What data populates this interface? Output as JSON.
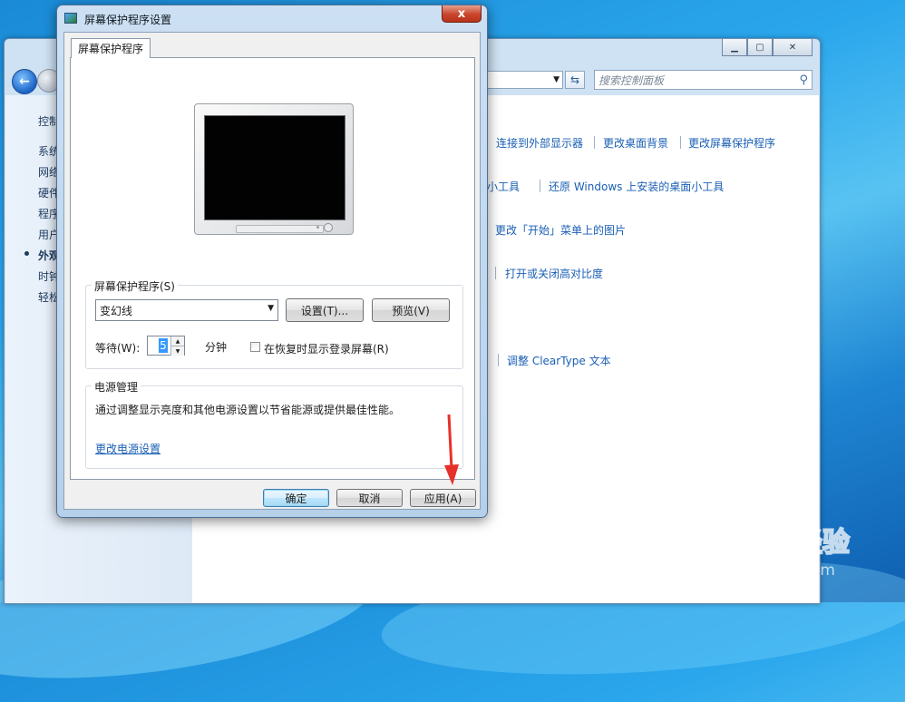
{
  "background_window": {
    "search_placeholder": "搜索控制面板",
    "sidebar_items": [
      "控制",
      "系统",
      "网络",
      "硬件",
      "程序",
      "用户",
      "外观",
      "时钟",
      "轻松"
    ],
    "content_links": [
      [
        "连接到外部显示器",
        "更改桌面背景",
        "更改屏幕保护程序"
      ],
      [
        "桌面小工具",
        "还原 Windows 上安装的桌面小工具"
      ],
      [
        "更改「开始」菜单上的图片"
      ],
      [
        "打开或关闭高对比度"
      ],
      [
        "调整 ClearType 文本"
      ]
    ]
  },
  "dialog": {
    "title": "屏幕保护程序设置",
    "close_label": "x",
    "tab_label": "屏幕保护程序",
    "saver_group_label": "屏幕保护程序(S)",
    "saver_selected": "变幻线",
    "settings_button": "设置(T)...",
    "preview_button": "预览(V)",
    "wait_label": "等待(W):",
    "wait_value": "5",
    "minutes_label": "分钟",
    "resume_checkbox_label": "在恢复时显示登录屏幕(R)",
    "power_group_label": "电源管理",
    "power_desc": "通过调整显示亮度和其他电源设置以节省能源或提供最佳性能。",
    "power_link": "更改电源设置",
    "ok_button": "确定",
    "cancel_button": "取消",
    "apply_button": "应用(A)"
  },
  "colors": {
    "link": "#1a5fb4",
    "annotation_arrow": "#e8302a",
    "close_button": "#c9452b"
  }
}
